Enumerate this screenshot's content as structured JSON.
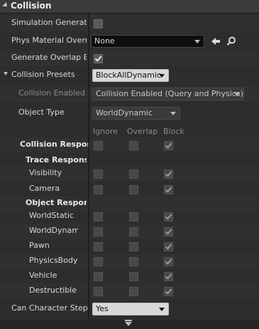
{
  "panel": {
    "title": "Collision"
  },
  "props": {
    "simulation_generates": {
      "label": "Simulation Generates",
      "checked": false
    },
    "phys_material_override": {
      "label": "Phys Material Overric",
      "value": "None"
    },
    "generate_overlap": {
      "label": "Generate Overlap Eve",
      "checked": true
    },
    "collision_presets": {
      "label": "Collision Presets",
      "value": "BlockAllDynamic"
    },
    "collision_enabled": {
      "label": "Collision Enabled",
      "value": "Collision Enabled (Query and Physics)"
    },
    "object_type": {
      "label": "Object Type",
      "value": "WorldDynamic"
    },
    "can_step_up": {
      "label": "Can Character Step U",
      "value": "Yes"
    }
  },
  "response_columns": {
    "ignore": "Ignore",
    "overlap": "Overlap",
    "block": "Block"
  },
  "responses": {
    "header": "Collision Responses",
    "trace_header": "Trace Response",
    "object_header": "Object Respons",
    "trace": [
      {
        "label": "Visibility",
        "ignore": false,
        "overlap": false,
        "block": true
      },
      {
        "label": "Camera",
        "ignore": false,
        "overlap": false,
        "block": true
      }
    ],
    "object": [
      {
        "label": "WorldStatic",
        "ignore": false,
        "overlap": false,
        "block": true
      },
      {
        "label": "WorldDynamic",
        "ignore": false,
        "overlap": false,
        "block": true
      },
      {
        "label": "Pawn",
        "ignore": false,
        "overlap": false,
        "block": true
      },
      {
        "label": "PhysicsBody",
        "ignore": false,
        "overlap": false,
        "block": true
      },
      {
        "label": "Vehicle",
        "ignore": false,
        "overlap": false,
        "block": true
      },
      {
        "label": "Destructible",
        "ignore": false,
        "overlap": false,
        "block": true
      }
    ]
  },
  "icons": {
    "use_selected": "arrow-left-icon",
    "browse": "search-icon",
    "advanced": "chevron-down-icon"
  }
}
